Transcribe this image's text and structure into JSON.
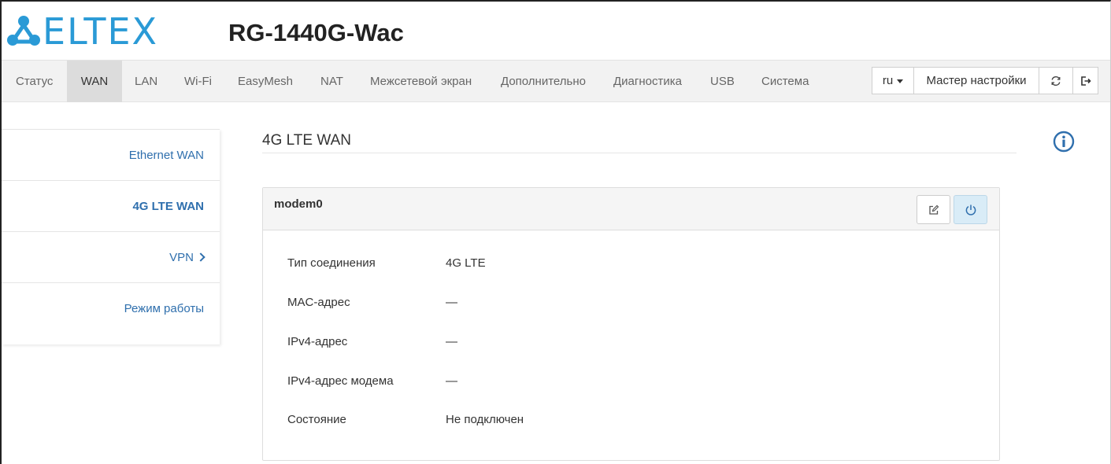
{
  "header": {
    "brand": "ELTEX",
    "model": "RG-1440G-Wac",
    "brand_color": "#2a9ad6"
  },
  "nav": {
    "items": [
      {
        "label": "Статус"
      },
      {
        "label": "WAN",
        "active": true
      },
      {
        "label": "LAN"
      },
      {
        "label": "Wi-Fi"
      },
      {
        "label": "EasyMesh"
      },
      {
        "label": "NAT"
      },
      {
        "label": "Межсетевой экран"
      },
      {
        "label": "Дополнительно"
      },
      {
        "label": "Диагностика"
      },
      {
        "label": "USB"
      },
      {
        "label": "Система"
      }
    ],
    "language": "ru",
    "wizard": "Мастер настройки",
    "refresh_icon": "refresh-icon",
    "logout_icon": "logout-icon"
  },
  "sidebar": {
    "items": [
      {
        "label": "Ethernet WAN"
      },
      {
        "label": "4G LTE WAN",
        "active": true
      },
      {
        "label": "VPN"
      },
      {
        "label": "Режим работы"
      }
    ]
  },
  "main": {
    "title": "4G LTE WAN",
    "info_icon": "info-icon",
    "panel": {
      "title": "modem0",
      "edit_icon": "edit-icon",
      "power_icon": "power-icon",
      "rows": [
        {
          "label": "Тип соединения",
          "value": "4G LTE"
        },
        {
          "label": "MAC-адрес",
          "value": "—"
        },
        {
          "label": "IPv4-адрес",
          "value": "—"
        },
        {
          "label": "IPv4-адрес модема",
          "value": "—"
        },
        {
          "label": "Состояние",
          "value": "Не подключен"
        }
      ]
    }
  },
  "colors": {
    "link": "#2f6fad",
    "active_nav": "#dcdcdc",
    "nav_bg": "#f2f2f2"
  }
}
